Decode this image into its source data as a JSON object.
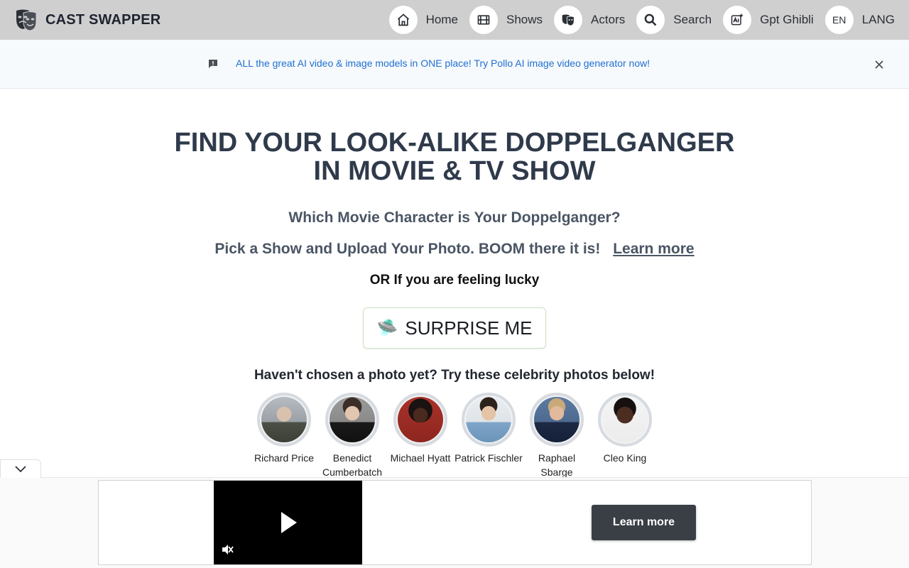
{
  "brand": {
    "title": "CAST SWAPPER",
    "logo_icon": "theater-masks-icon"
  },
  "nav": {
    "items": [
      {
        "label": "Home",
        "icon": "home-icon"
      },
      {
        "label": "Shows",
        "icon": "film-icon"
      },
      {
        "label": "Actors",
        "icon": "masks-icon"
      },
      {
        "label": "Search",
        "icon": "search-icon"
      },
      {
        "label": "Gpt Ghibli",
        "icon": "ai-image-icon"
      },
      {
        "label": "LANG",
        "badge": "EN"
      }
    ]
  },
  "banner": {
    "text": "ALL the great AI video & image models in ONE place! Try Pollo AI image video generator now!",
    "icon": "feedback-icon",
    "close_icon": "close-icon"
  },
  "hero": {
    "headline_line1": "FIND YOUR LOOK-ALIKE DOPPELGANGER",
    "headline_line2": "IN MOVIE & TV SHOW",
    "subtitle1": "Which Movie Character is Your Doppelganger?",
    "subtitle2": "Pick a Show and Upload Your Photo. BOOM there it is!",
    "learn_more": "Learn more",
    "lucky": "OR If you are feeling lucky",
    "surprise_emoji": "🛸",
    "surprise_label": "SURPRISE ME"
  },
  "celebs": {
    "prompt": "Haven't chosen a photo yet? Try these celebrity photos below!",
    "items": [
      {
        "name": "Richard Price"
      },
      {
        "name": "Benedict Cumberbatch"
      },
      {
        "name": "Michael Hyatt"
      },
      {
        "name": "Patrick Fischler"
      },
      {
        "name": "Raphael Sbarge"
      },
      {
        "name": "Cleo King"
      }
    ]
  },
  "ad": {
    "learn_more": "Learn more",
    "play_icon": "play-icon",
    "mute_icon": "muted-speaker-icon",
    "collapse_icon": "chevron-down-icon"
  },
  "colors": {
    "nav_bg": "#cfcfcf",
    "banner_text": "#1f6fd1",
    "heading": "#2f3a4b"
  }
}
